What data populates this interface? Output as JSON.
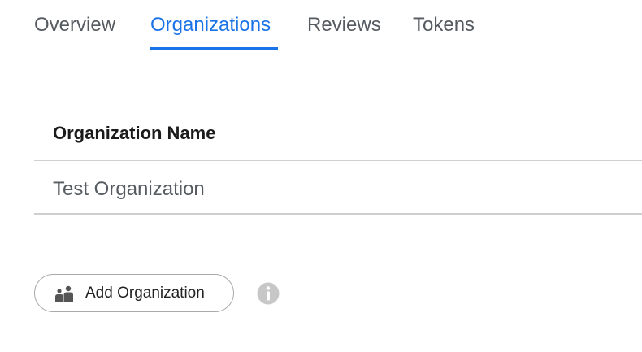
{
  "tabs": [
    {
      "label": "Overview",
      "active": false
    },
    {
      "label": "Organizations",
      "active": true
    },
    {
      "label": "Reviews",
      "active": false
    },
    {
      "label": "Tokens",
      "active": false
    }
  ],
  "colors": {
    "accent": "#1a73e8",
    "text_muted": "#555b61",
    "icon_gray": "#c7c7c7"
  },
  "table": {
    "column_header": "Organization Name",
    "rows": [
      {
        "name": "Test Organization"
      }
    ]
  },
  "actions": {
    "add_organization_label": "Add Organization",
    "add_organization_icon": "people-add-icon",
    "info_icon": "info-icon"
  }
}
